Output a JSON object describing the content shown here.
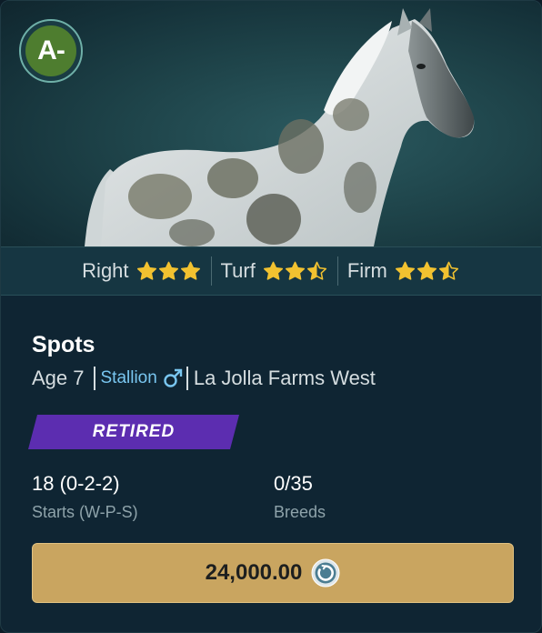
{
  "horse": {
    "grade": "A-",
    "name": "Spots",
    "age_label": "Age 7",
    "gender": "Stallion",
    "stable": "La Jolla Farms West",
    "status": "RETIRED"
  },
  "preferences": [
    {
      "label": "Right",
      "rating": 3.0
    },
    {
      "label": "Turf",
      "rating": 2.5
    },
    {
      "label": "Firm",
      "rating": 2.5
    }
  ],
  "stats": {
    "starts_value": "18 (0-2-2)",
    "starts_label": "Starts (W-P-S)",
    "breeds_value": "0/35",
    "breeds_label": "Breeds"
  },
  "price": {
    "amount": "24,000.00",
    "currency_icon": "coin-icon"
  },
  "colors": {
    "grade_green": "#4e7d2f",
    "status_purple": "#5c2db0",
    "star_gold": "#f2c230",
    "price_gold": "#c9a560",
    "gender_blue": "#79c6f0"
  }
}
